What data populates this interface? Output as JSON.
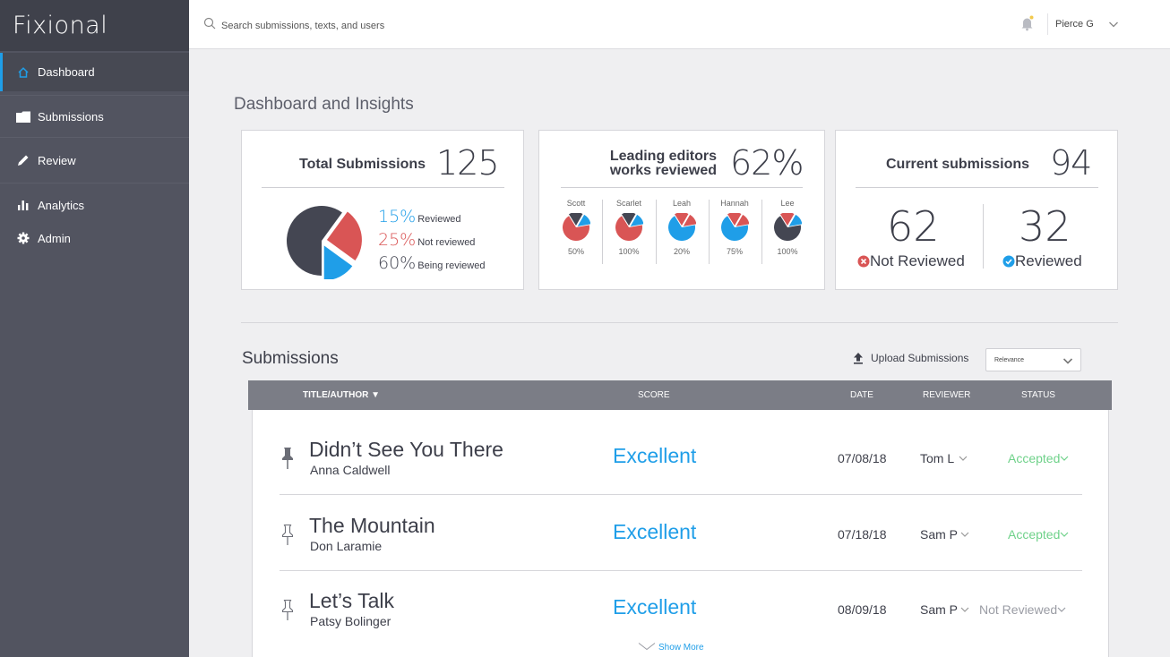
{
  "app": {
    "brand": "Fixional"
  },
  "sidebar": {
    "items": [
      {
        "label": "Dashboard",
        "icon": "home-icon",
        "active": true
      },
      {
        "label": "Submissions",
        "icon": "folder-icon"
      },
      {
        "label": "Review",
        "icon": "pencil-icon"
      },
      {
        "label": "Analytics",
        "icon": "bar-chart-icon"
      },
      {
        "label": "Admin",
        "icon": "gear-icon"
      }
    ]
  },
  "topbar": {
    "search_placeholder": "Search submissions, texts, and users",
    "user_name": "Pierce G",
    "notification_icon": "bell-icon"
  },
  "page_title": "Dashboard and Insights",
  "cards": {
    "total": {
      "label": "Total Submissions",
      "value": "125",
      "legend": [
        {
          "pct": "15%",
          "label": "Reviewed",
          "color": "#1f9ee8",
          "value": 15
        },
        {
          "pct": "25%",
          "label": "Not reviewed",
          "color": "#d95555",
          "value": 25
        },
        {
          "pct": "60%",
          "label": "Being reviewed",
          "color": "#444652",
          "value": 60
        }
      ]
    },
    "editors": {
      "label_line1": "Leading editors",
      "label_line2": "works reviewed",
      "value": "62%",
      "items": [
        {
          "name": "Scott",
          "pct": "50%",
          "main_color": "#d95555"
        },
        {
          "name": "Scarlet",
          "pct": "100%",
          "main_color": "#d95555"
        },
        {
          "name": "Leah",
          "pct": "20%",
          "main_color": "#1f9ee8"
        },
        {
          "name": "Hannah",
          "pct": "75%",
          "main_color": "#1f9ee8"
        },
        {
          "name": "Lee",
          "pct": "100%",
          "main_color": "#444652"
        }
      ]
    },
    "current": {
      "label": "Current submissions",
      "value": "94",
      "not_reviewed_count": "62",
      "not_reviewed_label": "Not Reviewed",
      "reviewed_count": "32",
      "reviewed_label": "Reviewed"
    }
  },
  "submissions": {
    "title": "Submissions",
    "upload_label": "Upload Submissions",
    "sort_value": "Relevance",
    "columns": {
      "title": "TITLE/AUTHOR",
      "score": "SCORE",
      "date": "DATE",
      "reviewer": "REVIEWER",
      "status": "STATUS"
    },
    "rows": [
      {
        "title": "Didn’t See You There",
        "author": "Anna Caldwell",
        "score": "Excellent",
        "date": "07/08/18",
        "reviewer": "Tom L",
        "status": "Accepted",
        "pinned": true
      },
      {
        "title": "The Mountain",
        "author": "Don Laramie",
        "score": "Excellent",
        "date": "07/18/18",
        "reviewer": "Sam P",
        "status": "Accepted",
        "pinned": false
      },
      {
        "title": "Let’s Talk",
        "author": "Patsy Bolinger",
        "score": "Excellent",
        "date": "08/09/18",
        "reviewer": "Sam P",
        "status": "Not Reviewed",
        "pinned": false
      }
    ],
    "show_more": "Show More"
  },
  "colors": {
    "accent": "#1f9ee8",
    "red": "#d95555",
    "dark": "#444652",
    "green": "#6fd28a",
    "muted": "#9a9ca4"
  }
}
